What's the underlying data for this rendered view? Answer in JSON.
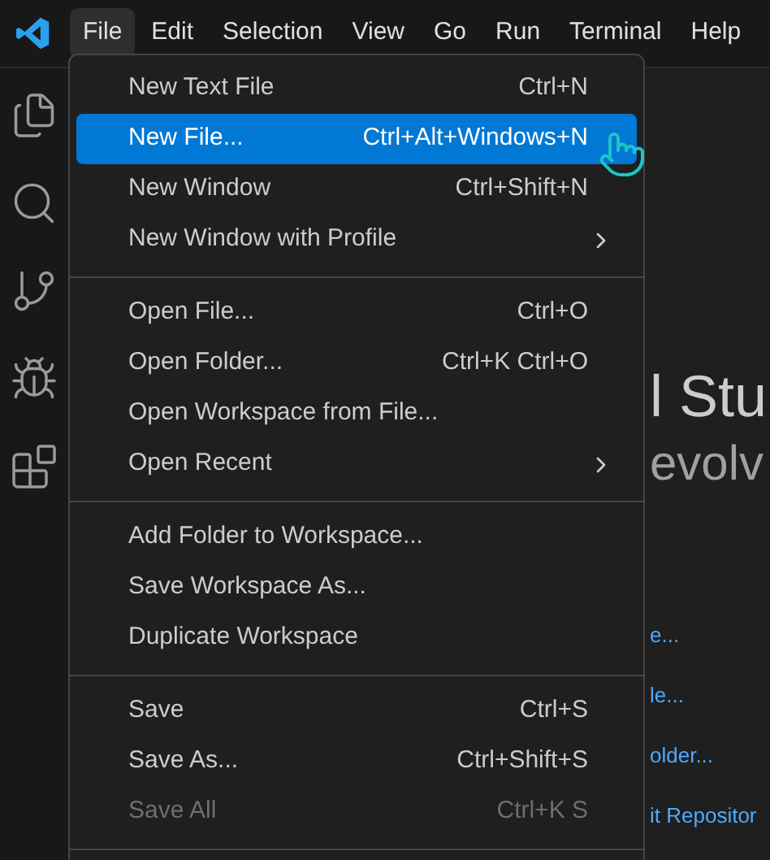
{
  "menu_bar": [
    {
      "label": "File",
      "selected": true
    },
    {
      "label": "Edit",
      "selected": false
    },
    {
      "label": "Selection",
      "selected": false
    },
    {
      "label": "View",
      "selected": false
    },
    {
      "label": "Go",
      "selected": false
    },
    {
      "label": "Run",
      "selected": false
    },
    {
      "label": "Terminal",
      "selected": false
    },
    {
      "label": "Help",
      "selected": false
    }
  ],
  "file_menu": {
    "sections": [
      [
        {
          "label": "New Text File",
          "shortcut": "Ctrl+N",
          "selected": false,
          "disabled": false,
          "submenu": false
        },
        {
          "label": "New File...",
          "shortcut": "Ctrl+Alt+Windows+N",
          "selected": true,
          "disabled": false,
          "submenu": false
        },
        {
          "label": "New Window",
          "shortcut": "Ctrl+Shift+N",
          "selected": false,
          "disabled": false,
          "submenu": false
        },
        {
          "label": "New Window with Profile",
          "selected": false,
          "disabled": false,
          "submenu": true
        }
      ],
      [
        {
          "label": "Open File...",
          "shortcut": "Ctrl+O",
          "selected": false,
          "disabled": false,
          "submenu": false
        },
        {
          "label": "Open Folder...",
          "shortcut": "Ctrl+K Ctrl+O",
          "selected": false,
          "disabled": false,
          "submenu": false
        },
        {
          "label": "Open Workspace from File...",
          "selected": false,
          "disabled": false,
          "submenu": false
        },
        {
          "label": "Open Recent",
          "selected": false,
          "disabled": false,
          "submenu": true
        }
      ],
      [
        {
          "label": "Add Folder to Workspace...",
          "selected": false,
          "disabled": false,
          "submenu": false
        },
        {
          "label": "Save Workspace As...",
          "selected": false,
          "disabled": false,
          "submenu": false
        },
        {
          "label": "Duplicate Workspace",
          "selected": false,
          "disabled": false,
          "submenu": false
        }
      ],
      [
        {
          "label": "Save",
          "shortcut": "Ctrl+S",
          "selected": false,
          "disabled": false,
          "submenu": false
        },
        {
          "label": "Save As...",
          "shortcut": "Ctrl+Shift+S",
          "selected": false,
          "disabled": false,
          "submenu": false
        },
        {
          "label": "Save All",
          "shortcut": "Ctrl+K S",
          "selected": false,
          "disabled": true,
          "submenu": false
        }
      ]
    ]
  },
  "editor": {
    "title": "l Stu",
    "subtitle": "evolv",
    "links": [
      "e...",
      "le...",
      "older...",
      "it Repositor"
    ]
  }
}
